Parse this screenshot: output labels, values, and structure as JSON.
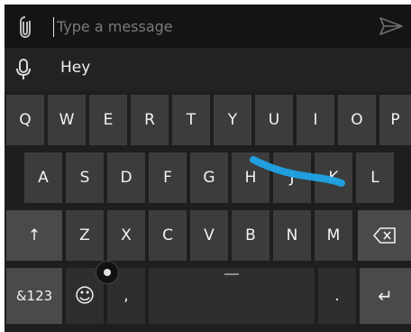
{
  "message_bar": {
    "placeholder": "Type a message",
    "attach_icon": "paperclip-icon",
    "send_icon": "send-icon"
  },
  "suggestions": {
    "mic_icon": "microphone-icon",
    "items": [
      "Hey"
    ]
  },
  "keyboard": {
    "row1": [
      "Q",
      "W",
      "E",
      "R",
      "T",
      "Y",
      "U",
      "I",
      "O",
      "P"
    ],
    "row2": [
      "A",
      "S",
      "D",
      "F",
      "G",
      "H",
      "J",
      "K",
      "L"
    ],
    "row3": [
      "Z",
      "X",
      "C",
      "V",
      "B",
      "N",
      "M"
    ],
    "shift_glyph": "↑",
    "backspace_icon": "backspace-icon",
    "numbers_label": "&123",
    "emoji_glyph": "☺",
    "comma_label": ",",
    "period_label": ".",
    "enter_glyph": "↵",
    "swipe_trace_color": "#1fa3e6"
  }
}
